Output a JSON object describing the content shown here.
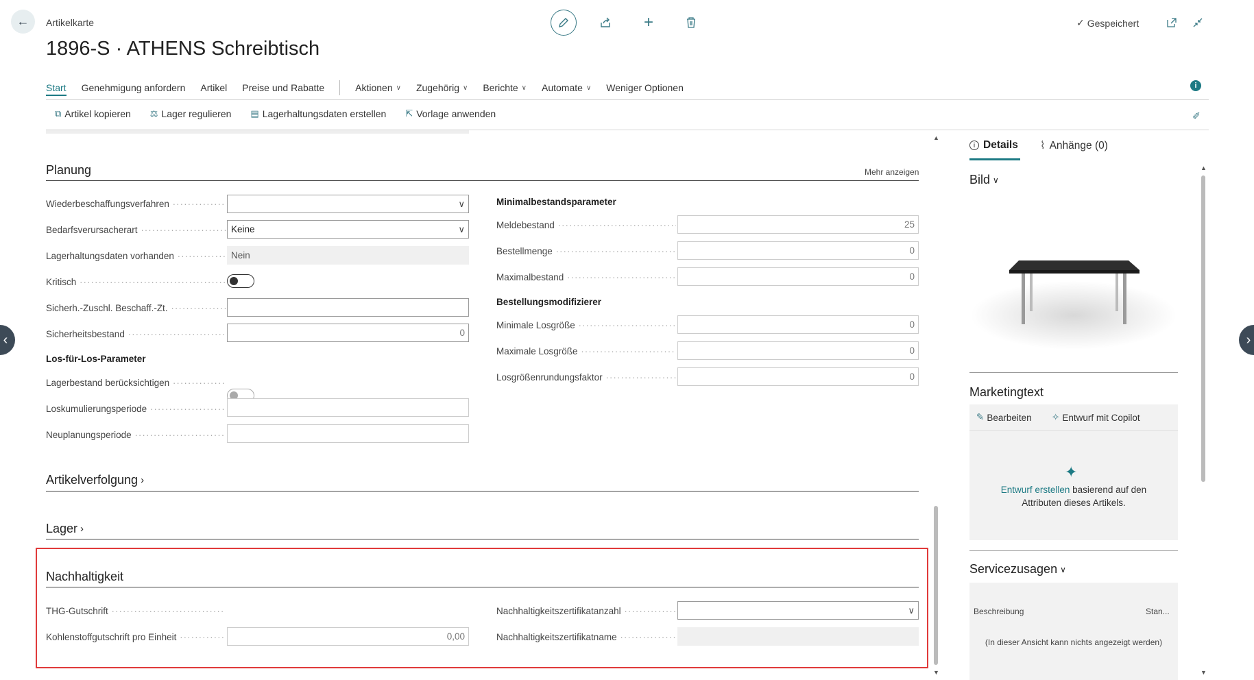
{
  "header": {
    "caption": "Artikelkarte",
    "title": "1896-S · ATHENS Schreibtisch",
    "saved_status": "Gespeichert"
  },
  "menu": {
    "items": [
      {
        "label": "Start"
      },
      {
        "label": "Genehmigung anfordern"
      },
      {
        "label": "Artikel"
      },
      {
        "label": "Preise und Rabatte"
      },
      {
        "label": "Aktionen"
      },
      {
        "label": "Zugehörig"
      },
      {
        "label": "Berichte"
      },
      {
        "label": "Automate"
      },
      {
        "label": "Weniger Optionen"
      }
    ]
  },
  "actions": {
    "items": [
      {
        "label": "Artikel kopieren"
      },
      {
        "label": "Lager regulieren"
      },
      {
        "label": "Lagerhaltungsdaten erstellen"
      },
      {
        "label": "Vorlage anwenden"
      }
    ]
  },
  "planung": {
    "title": "Planung",
    "show_more": "Mehr anzeigen",
    "left": {
      "wiederbeschaffung": {
        "label": "Wiederbeschaffungsverfahren",
        "value": ""
      },
      "bedarf": {
        "label": "Bedarfsverursacherart",
        "value": "Keine"
      },
      "lagerdaten": {
        "label": "Lagerhaltungsdaten vorhanden",
        "value": "Nein"
      },
      "kritisch": {
        "label": "Kritisch"
      },
      "sicherh_zt": {
        "label": "Sicherh.-Zuschl. Beschaff.-Zt.",
        "value": ""
      },
      "sicherheitsbestand": {
        "label": "Sicherheitsbestand",
        "value": "0"
      },
      "los_sub": "Los-für-Los-Parameter",
      "lagerbestand": {
        "label": "Lagerbestand berücksichtigen"
      },
      "loskum": {
        "label": "Loskumulierungsperiode",
        "value": ""
      },
      "neuplanung": {
        "label": "Neuplanungsperiode",
        "value": ""
      }
    },
    "right": {
      "min_sub": "Minimalbestandsparameter",
      "meldebestand": {
        "label": "Meldebestand",
        "value": "25"
      },
      "bestellmenge": {
        "label": "Bestellmenge",
        "value": "0"
      },
      "maximalbestand": {
        "label": "Maximalbestand",
        "value": "0"
      },
      "mod_sub": "Bestellungsmodifizierer",
      "min_los": {
        "label": "Minimale Losgröße",
        "value": "0"
      },
      "max_los": {
        "label": "Maximale Losgröße",
        "value": "0"
      },
      "rundung": {
        "label": "Losgrößenrundungsfaktor",
        "value": "0"
      }
    }
  },
  "sections": {
    "artikelverfolgung": "Artikelverfolgung",
    "lager": "Lager"
  },
  "nachhaltigkeit": {
    "title": "Nachhaltigkeit",
    "thg": {
      "label": "THG-Gutschrift"
    },
    "kohlenstoff": {
      "label": "Kohlenstoffgutschrift pro Einheit",
      "value": "0,00"
    },
    "zert_anzahl": {
      "label": "Nachhaltigkeitszertifikatanzahl",
      "value": ""
    },
    "zert_name": {
      "label": "Nachhaltigkeitszertifikatname",
      "value": ""
    }
  },
  "factbox": {
    "tab_details": "Details",
    "tab_attachments": "Anhänge (0)",
    "bild_title": "Bild",
    "marketing_title": "Marketingtext",
    "edit_label": "Bearbeiten",
    "copilot_label": "Entwurf mit Copilot",
    "draft_link": "Entwurf erstellen",
    "draft_text": " basierend auf den Attributen dieses Artikels.",
    "service_title": "Servicezusagen",
    "col_desc": "Beschreibung",
    "col_stan": "Stan...",
    "empty_text": "(In dieser Ansicht kann nichts angezeigt werden)"
  },
  "colors": {
    "accent": "#1d7a84",
    "highlight": "#e03a3a"
  }
}
